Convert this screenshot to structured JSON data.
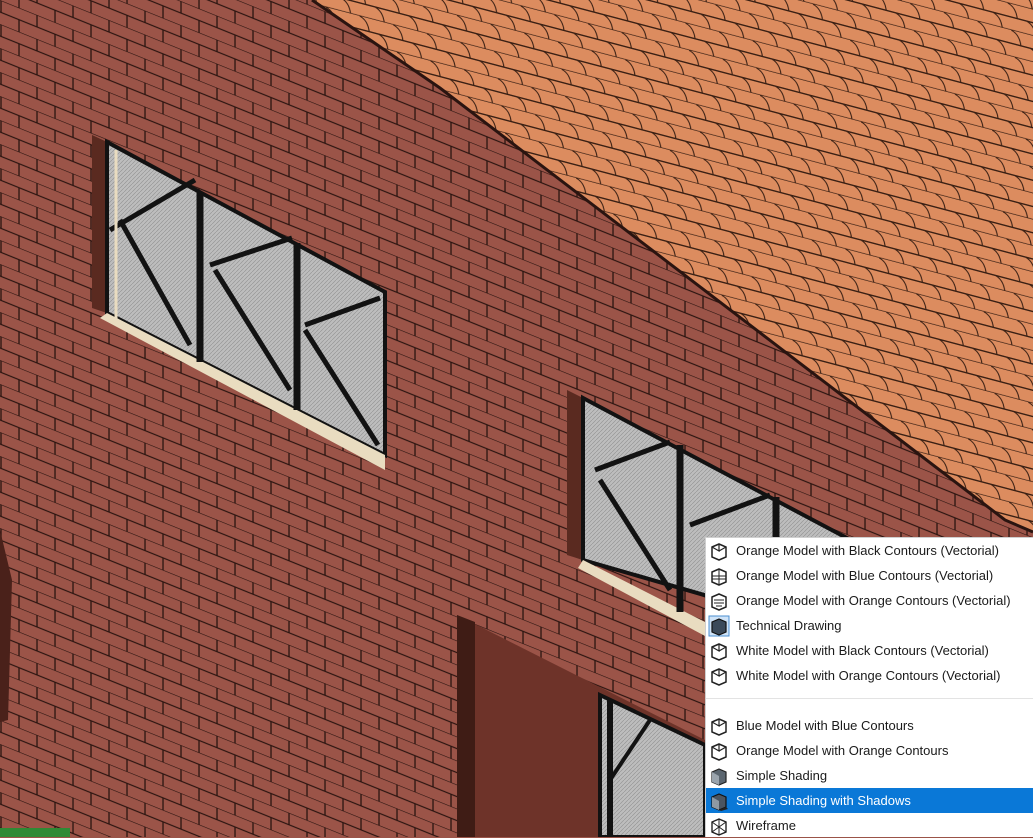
{
  "viewport": {
    "description_colors": {
      "brick": "#9b5448",
      "mortar": "#2a1410",
      "roof": "#dc8c5f",
      "roof_lines": "#3a2014",
      "glass": "#b9b9b9",
      "frame": "#e9dcc0",
      "selection": "#0a78d7"
    }
  },
  "style_menu": {
    "group_vectorial": [
      {
        "label": "Orange Model with Black Contours (Vectorial)",
        "icon": "orange-black-contours-icon"
      },
      {
        "label": "Orange Model with Blue Contours (Vectorial)",
        "icon": "orange-blue-contours-icon"
      },
      {
        "label": "Orange Model with Orange Contours (Vectorial)",
        "icon": "orange-orange-contours-icon"
      },
      {
        "label": "Technical Drawing",
        "icon": "technical-drawing-icon"
      },
      {
        "label": "White Model with Black Contours (Vectorial)",
        "icon": "white-black-contours-icon"
      },
      {
        "label": "White Model with Orange Contours (Vectorial)",
        "icon": "white-orange-contours-icon"
      }
    ],
    "group_raster": [
      {
        "label": "Blue Model with Blue Contours",
        "icon": "blue-blue-contours-icon"
      },
      {
        "label": "Orange Model with Orange Contours",
        "icon": "orange-contours-icon"
      },
      {
        "label": "Simple Shading",
        "icon": "simple-shading-icon"
      },
      {
        "label": "Simple Shading with Shadows",
        "icon": "shading-shadows-icon",
        "selected": true
      },
      {
        "label": "Wireframe",
        "icon": "wireframe-icon"
      }
    ]
  }
}
